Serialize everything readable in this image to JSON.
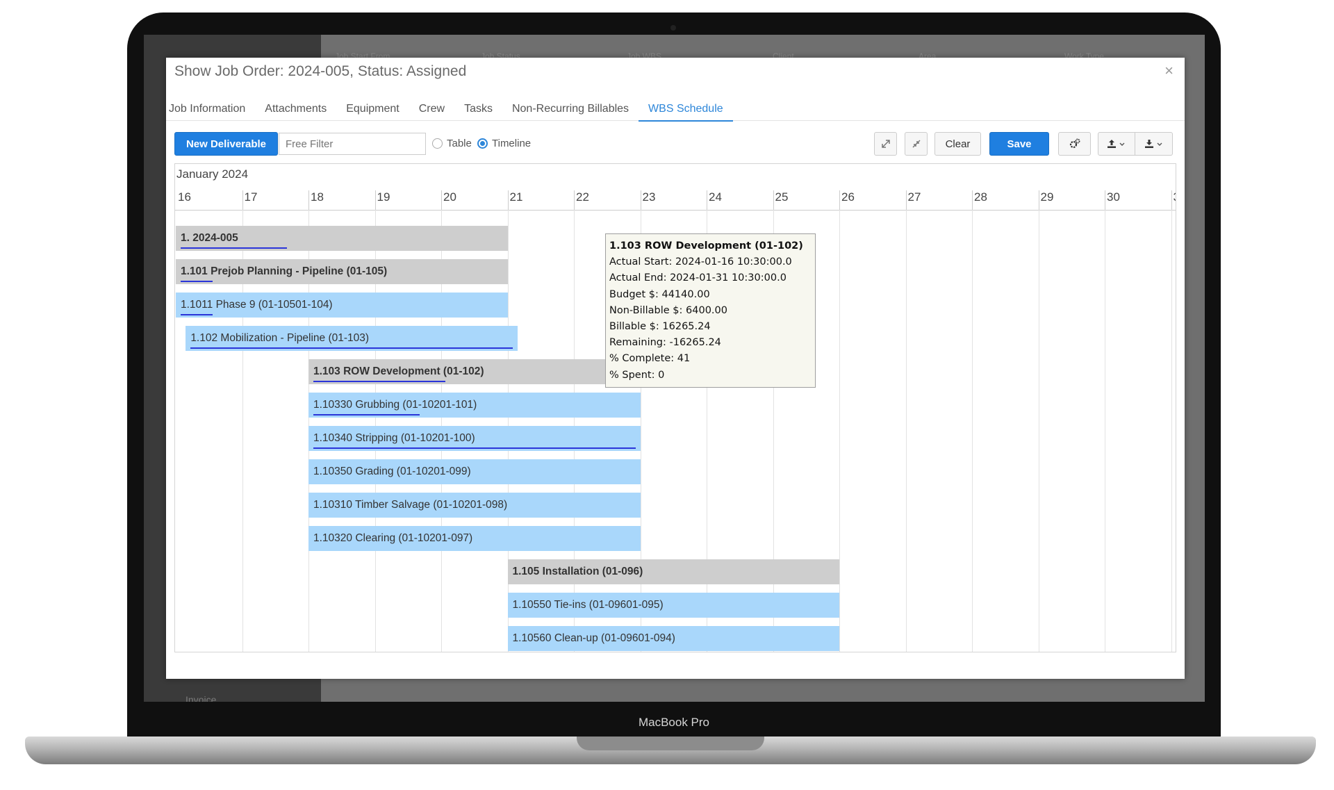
{
  "device": {
    "brand": "MacBook Pro"
  },
  "background_app": {
    "header_cols": [
      "Job Start From",
      "Job Status",
      "Job WBS",
      "Client",
      "Area",
      "Work Type"
    ],
    "sidebar_item": "Invoice"
  },
  "modal": {
    "title": "Show Job Order: 2024-005, Status: Assigned",
    "close_icon": "close-icon",
    "tabs": [
      {
        "label": "Job Information",
        "active": false
      },
      {
        "label": "Attachments",
        "active": false
      },
      {
        "label": "Equipment",
        "active": false
      },
      {
        "label": "Crew",
        "active": false
      },
      {
        "label": "Tasks",
        "active": false
      },
      {
        "label": "Non-Recurring Billables",
        "active": false
      },
      {
        "label": "WBS Schedule",
        "active": true
      }
    ]
  },
  "toolbar": {
    "new_deliverable": "New Deliverable",
    "filter_placeholder": "Free Filter",
    "radio_table": "Table",
    "radio_timeline": "Timeline",
    "selected_view": "Timeline",
    "expand_icon": "expand-icon",
    "collapse_icon": "collapse-icon",
    "clear": "Clear",
    "save": "Save",
    "settings_icon": "gears-icon",
    "upload_icon": "upload-icon",
    "download_icon": "download-icon",
    "dropdown_icon": "chevron-down-icon"
  },
  "timeline": {
    "month": "January 2024",
    "days": [
      "16",
      "17",
      "18",
      "19",
      "20",
      "21",
      "22",
      "23",
      "24",
      "25",
      "26",
      "27",
      "28",
      "29",
      "30",
      "3"
    ],
    "bars": [
      {
        "label": "1. 2024-005",
        "type": "group",
        "start": 16,
        "end": 21,
        "progress": 0.33
      },
      {
        "label": "1.101 Prejob Planning - Pipeline (01-105)",
        "type": "group",
        "start": 16,
        "end": 21,
        "progress": 0.1
      },
      {
        "label": "1.1011 Phase 9 (01-10501-104)",
        "type": "task",
        "start": 16,
        "end": 21,
        "progress": 0.1
      },
      {
        "label": "1.102 Mobilization - Pipeline (01-103)",
        "type": "task",
        "start": 16.15,
        "end": 21.15,
        "progress": 1.0
      },
      {
        "label": "1.103 ROW Development (01-102)",
        "type": "group",
        "start": 18,
        "end": 23,
        "progress": 0.41
      },
      {
        "label": "1.10330 Grubbing (01-10201-101)",
        "type": "task",
        "start": 18,
        "end": 23,
        "progress": 0.33
      },
      {
        "label": "1.10340 Stripping (01-10201-100)",
        "type": "task",
        "start": 18,
        "end": 23,
        "progress": 1.0
      },
      {
        "label": "1.10350 Grading (01-10201-099)",
        "type": "task",
        "start": 18,
        "end": 23,
        "progress": 0
      },
      {
        "label": "1.10310 Timber Salvage (01-10201-098)",
        "type": "task",
        "start": 18,
        "end": 23,
        "progress": 0
      },
      {
        "label": "1.10320 Clearing (01-10201-097)",
        "type": "task",
        "start": 18,
        "end": 23,
        "progress": 0
      },
      {
        "label": "1.105 Installation (01-096)",
        "type": "group",
        "start": 21,
        "end": 26,
        "progress": 0
      },
      {
        "label": "1.10550 Tie-ins (01-09601-095)",
        "type": "task",
        "start": 21,
        "end": 26,
        "progress": 0
      },
      {
        "label": "1.10560 Clean-up (01-09601-094)",
        "type": "task",
        "start": 21,
        "end": 26,
        "progress": 0
      }
    ],
    "tooltip": {
      "title": "1.103 ROW Development (01-102)",
      "lines": [
        "Actual Start: 2024-01-16 10:30:00.0",
        "Actual End: 2024-01-31 10:30:00.0",
        "Budget $: 44140.00",
        "Non-Billable $: 6400.00",
        "Billable $: 16265.24",
        "Remaining: -16265.24",
        "% Complete: 41",
        "% Spent: 0"
      ]
    }
  },
  "colors": {
    "accent": "#1f7fe0",
    "task_bar": "#a9d7fb",
    "group_bar": "#cecece",
    "progress_line": "#2b35d9"
  }
}
